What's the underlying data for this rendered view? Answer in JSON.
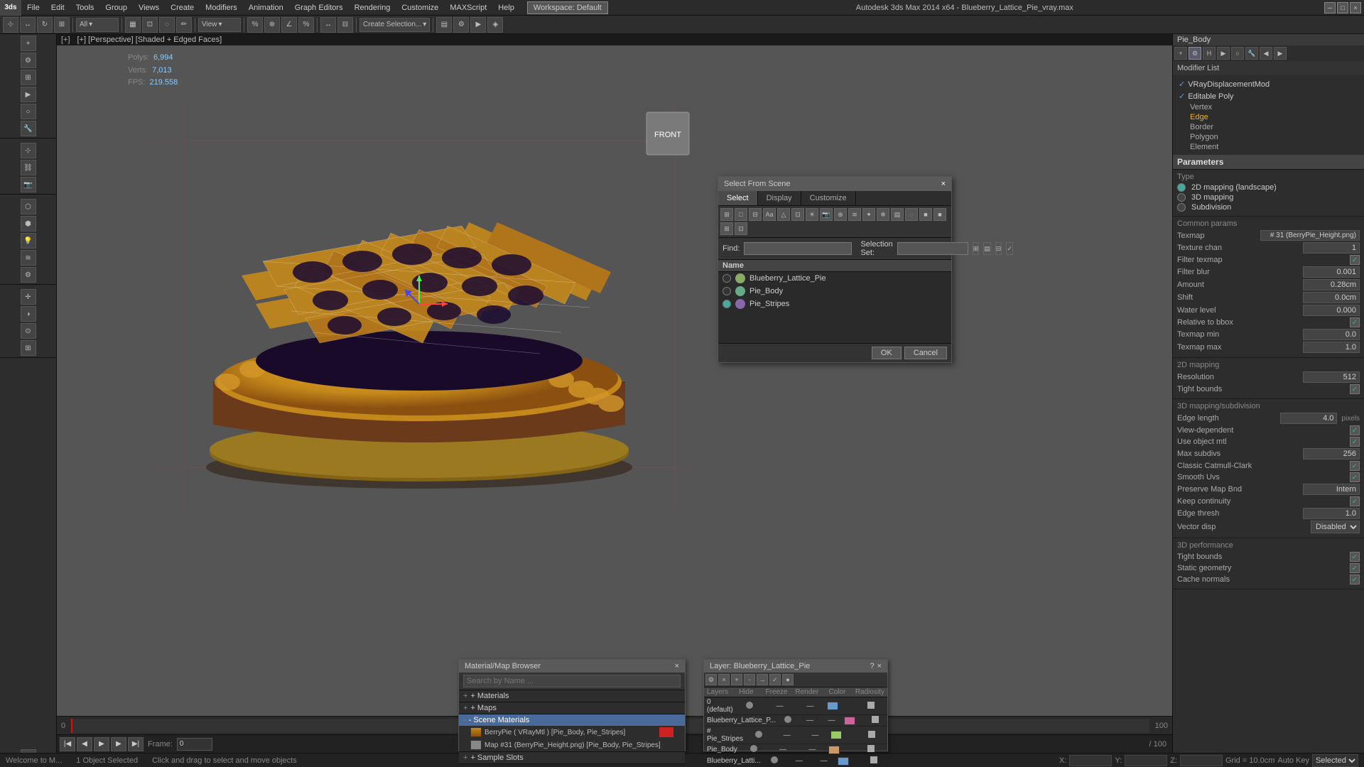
{
  "app": {
    "title": "Autodesk 3ds Max 2014 x64 - Blueberry_Lattice_Pie_vray.max",
    "logo": "3ds",
    "workspace": "Workspace: Default"
  },
  "menubar": {
    "items": [
      "File",
      "Edit",
      "Tools",
      "Group",
      "Views",
      "Create",
      "Modifiers",
      "Animation",
      "Graph Editors",
      "Rendering",
      "Customize",
      "MAXScript",
      "Help"
    ]
  },
  "toolbar": {
    "view_dropdown": "View",
    "select_filter": "All",
    "create_selection": "Create Selection..."
  },
  "viewport": {
    "label": "[+] [Perspective] [Shaded + Edged Faces]",
    "stats": {
      "polys_label": "Polys:",
      "polys_value": "6,994",
      "verts_label": "Verts:",
      "verts_value": "7,013",
      "fps_label": "FPS:",
      "fps_value": "219.558"
    }
  },
  "right_panel": {
    "object_name": "Pie_Body",
    "modifier_list_label": "Modifier List",
    "modifiers": [
      {
        "name": "VRayDisplacementMod",
        "active": true
      },
      {
        "name": "Editable Poly",
        "active": true
      },
      {
        "name": "Vertex",
        "sub": true
      },
      {
        "name": "Edge",
        "sub": true,
        "selected": true
      },
      {
        "name": "Border",
        "sub": true
      },
      {
        "name": "Polygon",
        "sub": true
      },
      {
        "name": "Element",
        "sub": true
      }
    ]
  },
  "parameters": {
    "header": "Parameters",
    "type": {
      "label": "Type",
      "option1": "2D mapping (landscape)",
      "option2": "3D mapping",
      "option3": "Subdivision"
    },
    "common": {
      "label": "Common params",
      "texmap_label": "Texmap",
      "texmap_value": "# 31 (BerryPie_Height.png)",
      "texture_chan_label": "Texture chan",
      "texture_chan_value": "1",
      "filter_texmap_label": "Filter texmap",
      "filter_blur_label": "Filter blur",
      "filter_blur_value": "0.001",
      "amount_label": "Amount",
      "amount_value": "0.28cm",
      "shift_label": "Shift",
      "shift_value": "0.0cm",
      "water_level_label": "Water level",
      "water_level_value": "0.000",
      "relative_bbox_label": "Relative to bbox",
      "texmap_min_label": "Texmap min",
      "texmap_min_value": "0.0",
      "texmap_max_label": "Texmap max",
      "texmap_max_value": "1.0"
    },
    "mapping_2d": {
      "label": "2D mapping",
      "resolution_label": "Resolution",
      "resolution_value": "512",
      "tight_bounds_label": "Tight bounds"
    },
    "mapping_3d": {
      "label": "3D mapping/subdivision",
      "edge_length_label": "Edge length",
      "edge_length_value": "4.0",
      "unit": "pixels",
      "view_dependent_label": "View-dependent",
      "use_object_mtl_label": "Use object mtl",
      "max_subdivs_label": "Max subdivs",
      "max_subdivs_value": "256",
      "classic_catmull_label": "Classic Catmull-Clark",
      "smooth_uv_label": "Smooth Uvs",
      "preserve_map_border_label": "Preserve Map Bnd",
      "preserve_map_border_value": "Intern",
      "keep_continuity_label": "Keep continuity",
      "edge_thresh_label": "Edge thresh",
      "edge_thresh_value": "1.0",
      "vector_disp_label": "Vector disp",
      "vector_disp_value": "Disabled"
    },
    "performance": {
      "label": "3D performance",
      "tight_bounds_label": "Tight bounds",
      "static_geometry_label": "Static geometry",
      "cache_normals_label": "Cache normals"
    }
  },
  "select_dialog": {
    "title": "Select From Scene",
    "close_btn": "×",
    "tabs": [
      "Select",
      "Display",
      "Customize"
    ],
    "active_tab": "Select",
    "find_label": "Find:",
    "selection_set_label": "Selection Set:",
    "list_header": "Name",
    "items": [
      {
        "name": "Blueberry_Lattice_Pie",
        "selected": false
      },
      {
        "name": "Pie_Body",
        "selected": false
      },
      {
        "name": "Pie_Stripes",
        "selected": false
      }
    ],
    "ok_btn": "OK",
    "cancel_btn": "Cancel"
  },
  "material_browser": {
    "title": "Material/Map Browser",
    "close_btn": "×",
    "search_placeholder": "Search by Name ...",
    "sections": [
      {
        "label": "+ Materials",
        "expanded": false
      },
      {
        "label": "+ Maps",
        "expanded": false
      },
      {
        "label": "- Scene Materials",
        "expanded": true
      },
      {
        "label": "+ Sample Slots",
        "expanded": false
      }
    ],
    "scene_materials": [
      {
        "name": "BerryPie ( VRayMtl ) [Pie_Body, Pie_Stripes]",
        "has_swatch": true
      },
      {
        "name": "Map #31 (BerryPie_Height.png) [Pie_Body, Pie_Stripes]",
        "has_swatch": false
      }
    ]
  },
  "layer_window": {
    "title": "Layer: Blueberry_Lattice_Pie",
    "columns": [
      "Layers",
      "Hide",
      "Freeze",
      "Render",
      "Color",
      "Radiosity"
    ],
    "layers": [
      {
        "name": "0 (default)",
        "hide": "—",
        "freeze": "—",
        "render": "—",
        "color": "#6699cc"
      },
      {
        "name": "Blueberry_Lattice_P...",
        "hide": "—",
        "freeze": "—",
        "render": "—",
        "color": "#cc6699"
      },
      {
        "name": "# Pie_Stripes",
        "hide": "—",
        "freeze": "—",
        "render": "—",
        "color": "#99cc66"
      },
      {
        "name": "Pie_Body",
        "hide": "—",
        "freeze": "—",
        "render": "—",
        "color": "#cc9966"
      },
      {
        "name": "Blueberry_Latti...",
        "hide": "—",
        "freeze": "—",
        "render": "—",
        "color": "#6699cc"
      }
    ]
  },
  "timeline": {
    "current_frame": "0",
    "total_frames": "100",
    "start": "0",
    "end": "100"
  },
  "statusbar": {
    "selection": "1 Object Selected",
    "hint": "Click and drag to select and move objects",
    "grid": "Grid = 10.0cm",
    "autokey": "Auto Key",
    "autokey_filter": "Selected"
  },
  "icons": {
    "close": "×",
    "minimize": "─",
    "maximize": "□",
    "arrow_right": "▶",
    "arrow_left": "◀",
    "check": "✓",
    "triangle_down": "▼",
    "triangle_right": "▶"
  }
}
